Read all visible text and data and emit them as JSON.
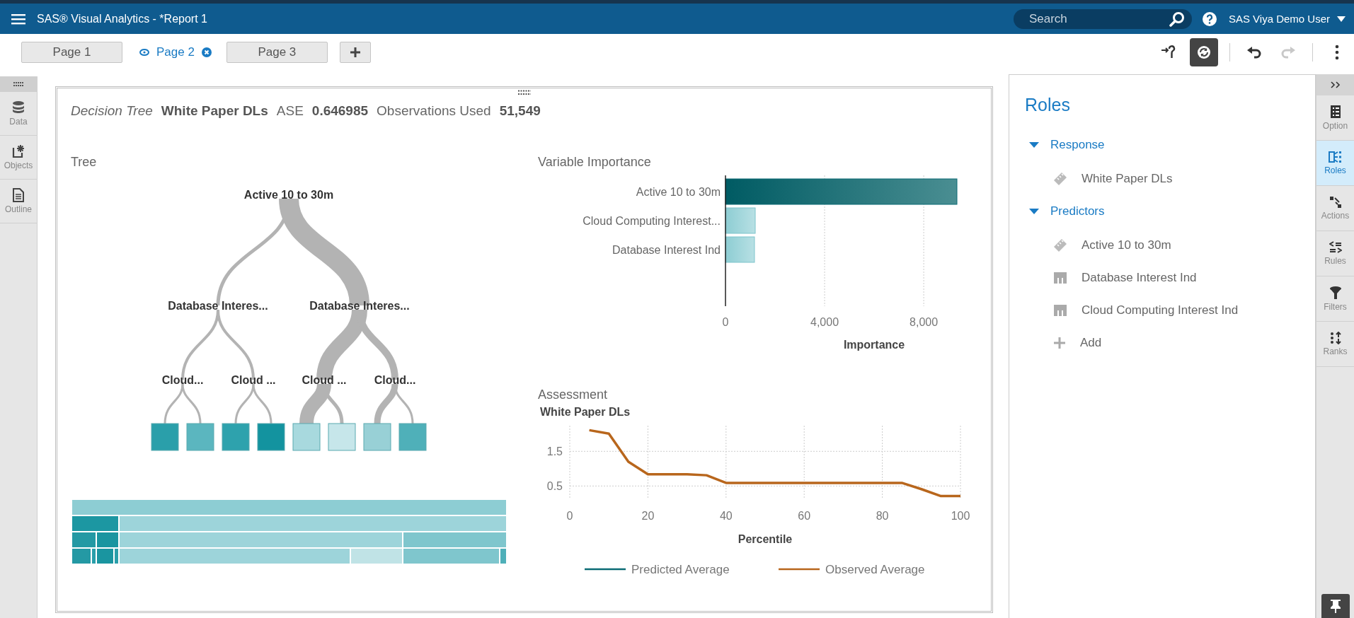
{
  "app_bar": {
    "title": "SAS® Visual Analytics - *Report 1",
    "search": {
      "placeholder": "Search"
    },
    "user": "SAS Viya Demo User"
  },
  "page_tabs": [
    {
      "label": "Page 1",
      "selected": false
    },
    {
      "label": "Page 2",
      "selected": true
    },
    {
      "label": "Page 3",
      "selected": false
    }
  ],
  "toolbar": {
    "redo_disabled": true
  },
  "left_sidebar": [
    {
      "label": "Data",
      "kind": "data"
    },
    {
      "label": "Objects",
      "kind": "objects"
    },
    {
      "label": "Outline",
      "kind": "outline"
    }
  ],
  "report_object": {
    "header": {
      "model_type": "Decision Tree",
      "response": "White Paper DLs",
      "stat_label": "ASE",
      "stat_value": "0.646985",
      "obs_label": "Observations Used",
      "obs_value": "51,549"
    },
    "tree": {
      "title": "Tree",
      "root": {
        "label": "Active 10 to 30m",
        "children": [
          {
            "label": "Database Interes...",
            "children": [
              {
                "label": "Cloud...",
                "children": [
                  {
                    "color": "#2a9faa"
                  },
                  {
                    "color": "#5bb6bf"
                  }
                ]
              },
              {
                "label": "Cloud ...",
                "children": [
                  {
                    "color": "#2ea2ad"
                  },
                  {
                    "color": "#13939f"
                  }
                ]
              }
            ]
          },
          {
            "label": "Database Interes...",
            "children": [
              {
                "label": "Cloud ...",
                "children": [
                  {
                    "color": "#a8d9de"
                  },
                  {
                    "color": "#c6e6ea"
                  }
                ]
              },
              {
                "label": "Cloud...",
                "children": [
                  {
                    "color": "#98d0d6"
                  },
                  {
                    "color": "#4fb0b9"
                  }
                ]
              }
            ]
          }
        ]
      }
    },
    "variable_importance": {
      "chart_data": {
        "type": "bar",
        "orientation": "horizontal",
        "title": "Variable Importance",
        "xlabel": "Importance",
        "categories": [
          "Active 10 to 30m",
          "Cloud Computing Interest...",
          "Database Interest Ind"
        ],
        "series": [
          {
            "values": [
              9340,
              1200,
              1170
            ]
          }
        ],
        "grid": true,
        "xlim": [
          0,
          9340
        ],
        "xticks": [
          0,
          {
            "value": 4000,
            "label": "4,000"
          },
          {
            "value": 8000,
            "label": "8,000"
          }
        ]
      }
    },
    "assessment": {
      "chart_data": {
        "type": "line",
        "title": "Assessment",
        "ylabel": "White Paper DLs",
        "xlabel": "Percentile",
        "x": [
          5,
          10,
          15,
          20,
          25,
          30,
          35,
          40,
          45,
          50,
          55,
          60,
          65,
          70,
          75,
          80,
          85,
          90,
          95,
          100
        ],
        "series": [
          {
            "name": "Predicted Average",
            "color": "#0b6b74",
            "values": [
              null,
              null,
              null,
              null,
              null,
              null,
              null,
              null,
              null,
              null,
              null,
              null,
              null,
              null,
              null,
              null,
              null,
              null,
              null,
              null
            ]
          },
          {
            "name": "Observed Average",
            "color": "#b8661c",
            "values": [
              2.11,
              2.01,
              1.2,
              0.84,
              0.84,
              0.84,
              0.81,
              0.59,
              0.59,
              0.59,
              0.59,
              0.59,
              0.59,
              0.59,
              0.59,
              0.59,
              0.59,
              0.41,
              0.21,
              0.21
            ]
          }
        ],
        "xlim": [
          0,
          100
        ],
        "ylim": [
          0.16,
          2.24
        ],
        "grid": true,
        "xticks": [
          0,
          20,
          40,
          60,
          80,
          100
        ],
        "yticks": [
          0.5,
          1.5
        ]
      }
    }
  },
  "roles_panel": {
    "title": "Roles",
    "sections": [
      {
        "label": "Response",
        "expanded": true,
        "items": [
          {
            "kind": "measure",
            "label": "White Paper DLs"
          }
        ]
      },
      {
        "label": "Predictors",
        "expanded": true,
        "items": [
          {
            "kind": "measure",
            "label": "Active 10 to 30m"
          },
          {
            "kind": "category",
            "label": "Database Interest Ind"
          },
          {
            "kind": "category",
            "label": "Cloud Computing Interest Ind"
          }
        ]
      }
    ],
    "add_label": "Add"
  },
  "right_sidebar": [
    {
      "label": "Option",
      "kind": "options",
      "selected": false
    },
    {
      "label": "Roles",
      "kind": "roles",
      "selected": true
    },
    {
      "label": "Actions",
      "kind": "actions",
      "selected": false
    },
    {
      "label": "Rules",
      "kind": "rules",
      "selected": false
    },
    {
      "label": "Filters",
      "kind": "filters",
      "selected": false
    },
    {
      "label": "Ranks",
      "kind": "ranks",
      "selected": false
    }
  ]
}
